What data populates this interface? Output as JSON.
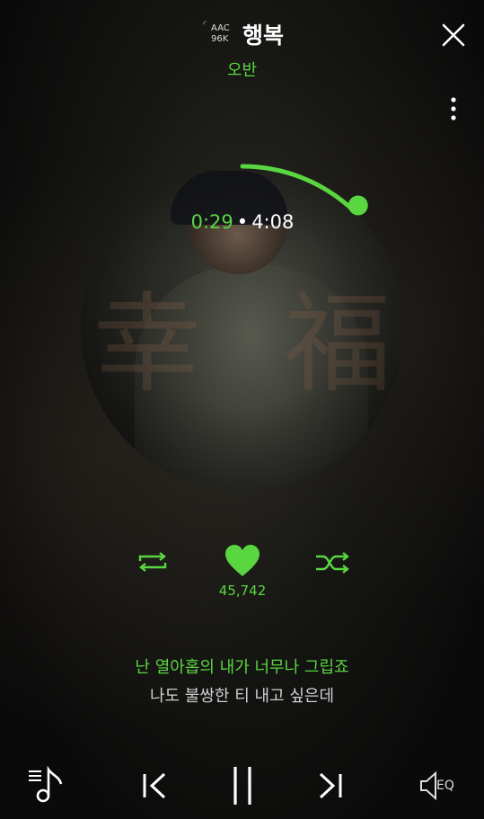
{
  "header": {
    "codec_line1": "AAC",
    "codec_line2": "96K",
    "title": "행복",
    "artist": "오반"
  },
  "player": {
    "elapsed": "0:29",
    "separator": "•",
    "total": "4:08",
    "progress_fraction": 0.117,
    "album_art_text": [
      "幸",
      "福"
    ],
    "like_count": "45,742"
  },
  "lyrics": {
    "current": "난 열아홉의 내가 너무나 그립죠",
    "next": "나도 불쌍한 티 내고 싶은데"
  },
  "bottom_bar": {
    "eq_label": "EQ"
  },
  "icons": {
    "close": "close-icon",
    "more": "more-vertical-icon",
    "repeat": "repeat-icon",
    "heart": "heart-icon",
    "shuffle": "shuffle-icon",
    "playlist": "playlist-icon",
    "prev": "previous-track-icon",
    "pause": "pause-icon",
    "next": "next-track-icon",
    "eq": "equalizer-icon"
  },
  "colors": {
    "accent": "#5ad641",
    "background": "#0b0b0b",
    "text_primary": "#ffffff",
    "text_secondary": "#cfcfcf"
  }
}
